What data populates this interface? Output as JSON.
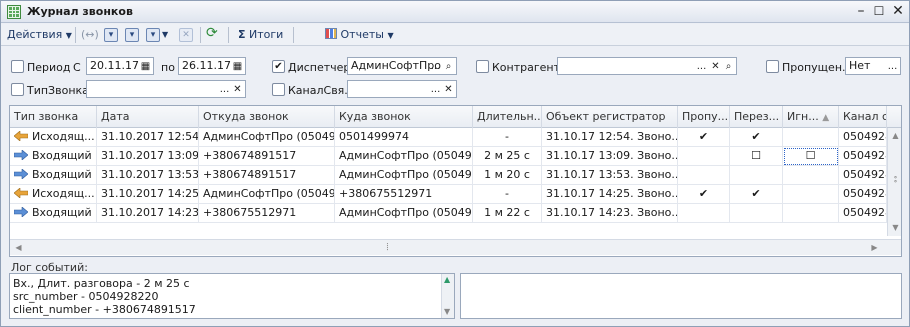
{
  "window": {
    "title": "Журнал звонков"
  },
  "toolbar": {
    "actions_label": "Действия",
    "totals_label": "Итоги",
    "totals_glyph": "Σ",
    "reports_label": "Отчеты"
  },
  "filters": {
    "period": {
      "label": "Период",
      "checked": false
    },
    "from_label": "С",
    "date_from": "20.11.17",
    "to_label": "по",
    "date_to": "26.11.17",
    "dispatcher": {
      "label": "Диспетчер",
      "checked": true,
      "value": "АдминСофтПро"
    },
    "counterparty": {
      "label": "Контрагент",
      "checked": false,
      "value": ""
    },
    "missed": {
      "label": "Пропущен...",
      "checked": false,
      "value": "Нет"
    },
    "call_type": {
      "label": "ТипЗвонка",
      "checked": false,
      "value": ""
    },
    "channel": {
      "label": "КаналСвя...",
      "checked": false,
      "value": ""
    }
  },
  "table": {
    "columns": [
      "Тип звонка",
      "Дата",
      "Откуда звонок",
      "Куда звонок",
      "Длительн...",
      "Объект регистратор",
      "Пропу...",
      "Перез...",
      "Игн...",
      "Канал с"
    ],
    "rows": [
      {
        "type": "Исходящ...",
        "direction": "out",
        "date": "31.10.2017 12:54...",
        "from": "АдминСофтПро (05049...",
        "to": "0501499974",
        "duration": "-",
        "registrar": "31.10.17 12:54.  Звоно...",
        "missed": "✔",
        "callback": "✔",
        "ignore": "",
        "channel": "0504928"
      },
      {
        "type": "Входящий",
        "direction": "in",
        "date": "31.10.2017 13:09...",
        "from": "+380674891517",
        "to": "АдминСофтПро (05049...",
        "duration": "2 м 25 с",
        "registrar": "31.10.17 13:09.  Звоно...",
        "missed": "",
        "callback": "☐",
        "ignore": "☐",
        "channel": "0504928"
      },
      {
        "type": "Входящий",
        "direction": "in",
        "date": "31.10.2017 13:53...",
        "from": "+380674891517",
        "to": "АдминСофтПро (05049...",
        "duration": "1 м 20 с",
        "registrar": "31.10.17 13:53.  Звоно...",
        "missed": "",
        "callback": "",
        "ignore": "",
        "channel": "0504928"
      },
      {
        "type": "Исходящ...",
        "direction": "out",
        "date": "31.10.2017 14:25...",
        "from": "АдминСофтПро (05049...",
        "to": "+380675512971",
        "duration": "-",
        "registrar": "31.10.17 14:25.  Звоно...",
        "missed": "✔",
        "callback": "✔",
        "ignore": "",
        "channel": "0504928"
      },
      {
        "type": "Входящий",
        "direction": "in",
        "date": "31.10.2017 14:23...",
        "from": "+380675512971",
        "to": "АдминСофтПро (05049...",
        "duration": "1 м 22 с",
        "registrar": "31.10.17 14:23.  Звоно...",
        "missed": "",
        "callback": "",
        "ignore": "",
        "channel": "0504928"
      }
    ]
  },
  "log": {
    "label": "Лог событий:",
    "lines": [
      "Вх., Длит. разговора - 2 м 25 с",
      "src_number - 0504928220",
      "client_number - +380674891517"
    ]
  },
  "colors": {
    "outgoing_arrow": "#e8a43a",
    "incoming_arrow": "#5b8fd6",
    "selected_cell": "#2d64c8"
  }
}
